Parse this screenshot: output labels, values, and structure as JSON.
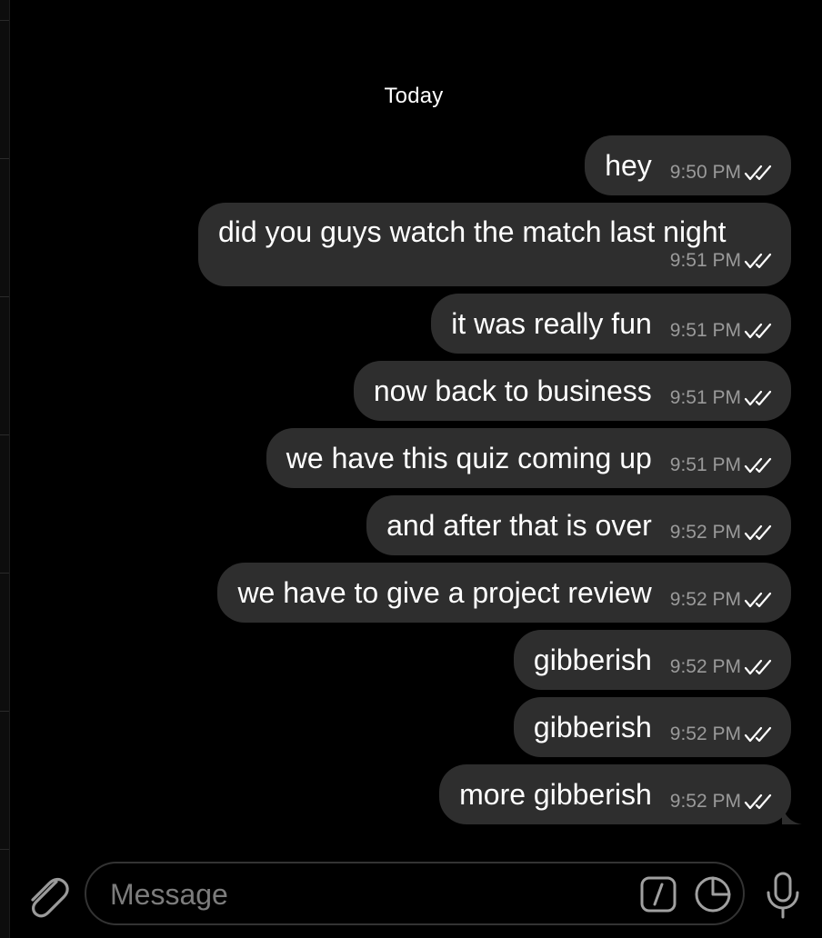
{
  "chat": {
    "date_header": "Today",
    "messages": [
      {
        "text": "hey",
        "time": "9:50 PM",
        "status": "read"
      },
      {
        "text": "did you guys watch the match last night",
        "time": "9:51 PM",
        "status": "read"
      },
      {
        "text": "it was really fun",
        "time": "9:51 PM",
        "status": "read"
      },
      {
        "text": "now back to business",
        "time": "9:51 PM",
        "status": "read"
      },
      {
        "text": "we have this quiz coming up",
        "time": "9:51 PM",
        "status": "read"
      },
      {
        "text": "and after that is over",
        "time": "9:52 PM",
        "status": "read"
      },
      {
        "text": "we have to give a project review",
        "time": "9:52 PM",
        "status": "read"
      },
      {
        "text": "gibberish",
        "time": "9:52 PM",
        "status": "read"
      },
      {
        "text": "gibberish",
        "time": "9:52 PM",
        "status": "read"
      },
      {
        "text": "more gibberish",
        "time": "9:52 PM",
        "status": "read"
      }
    ]
  },
  "composer": {
    "placeholder": "Message",
    "value": "",
    "icons": {
      "attach": "paperclip-icon",
      "commands": "slash-command-icon",
      "stickers": "sticker-icon",
      "voice": "microphone-icon"
    }
  },
  "colors": {
    "background": "#000000",
    "bubble": "#2e2e2e",
    "text": "#ffffff",
    "meta": "#9a9a9a",
    "input_border": "#333333",
    "placeholder": "#7c7c7c"
  }
}
